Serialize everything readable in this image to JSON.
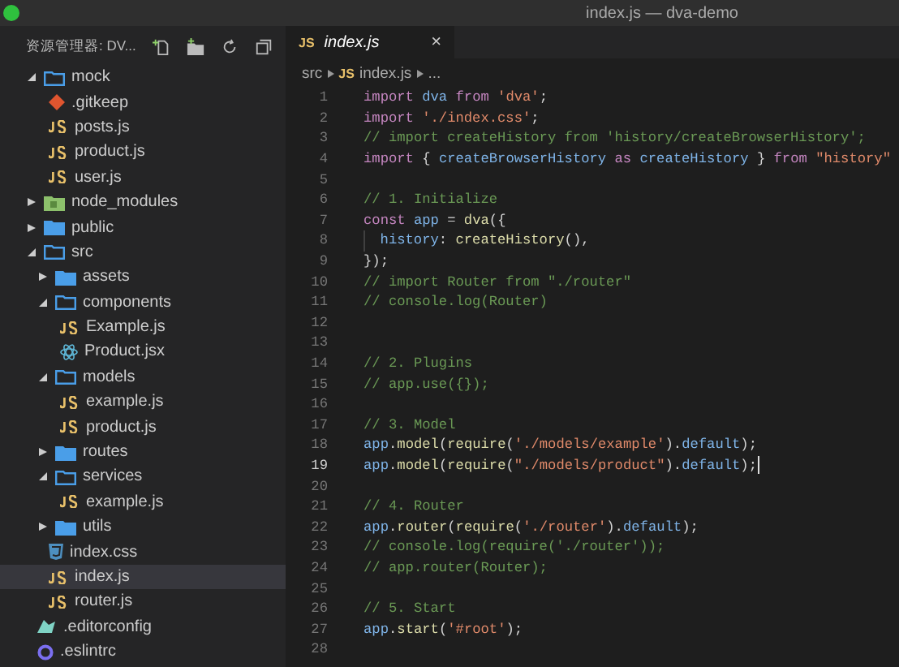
{
  "window": {
    "title": "index.js — dva-demo"
  },
  "sidebar": {
    "title": "资源管理器: DV...",
    "tree": [
      {
        "label": "mock",
        "kind": "folder",
        "expanded": true,
        "selected": false,
        "children": [
          {
            "label": ".gitkeep",
            "kind": "git",
            "selected": false
          },
          {
            "label": "posts.js",
            "kind": "js",
            "selected": false
          },
          {
            "label": "product.js",
            "kind": "js",
            "selected": false
          },
          {
            "label": "user.js",
            "kind": "js",
            "selected": false
          }
        ]
      },
      {
        "label": "node_modules",
        "kind": "node",
        "expanded": false,
        "selected": false
      },
      {
        "label": "public",
        "kind": "folder",
        "expanded": false,
        "selected": false
      },
      {
        "label": "src",
        "kind": "folder",
        "expanded": true,
        "selected": false,
        "children": [
          {
            "label": "assets",
            "kind": "folder",
            "expanded": false,
            "selected": false
          },
          {
            "label": "components",
            "kind": "folder",
            "expanded": true,
            "selected": false,
            "children": [
              {
                "label": "Example.js",
                "kind": "js",
                "selected": false
              },
              {
                "label": "Product.jsx",
                "kind": "jsx",
                "selected": false
              }
            ]
          },
          {
            "label": "models",
            "kind": "folder",
            "expanded": true,
            "selected": false,
            "children": [
              {
                "label": "example.js",
                "kind": "js",
                "selected": false
              },
              {
                "label": "product.js",
                "kind": "js",
                "selected": false
              }
            ]
          },
          {
            "label": "routes",
            "kind": "folder",
            "expanded": false,
            "selected": false
          },
          {
            "label": "services",
            "kind": "folder",
            "expanded": true,
            "selected": false,
            "children": [
              {
                "label": "example.js",
                "kind": "js",
                "selected": false
              }
            ]
          },
          {
            "label": "utils",
            "kind": "folder",
            "expanded": false,
            "selected": false
          },
          {
            "label": "index.css",
            "kind": "css",
            "selected": false
          },
          {
            "label": "index.js",
            "kind": "js",
            "selected": true
          },
          {
            "label": "router.js",
            "kind": "js",
            "selected": false
          }
        ]
      },
      {
        "label": ".editorconfig",
        "kind": "editorconfig",
        "selected": false
      },
      {
        "label": ".eslintrc",
        "kind": "eslint",
        "selected": false
      }
    ]
  },
  "tabs": [
    {
      "label": "index.js",
      "badge": "JS",
      "close": "×",
      "selected": true
    }
  ],
  "breadcrumb": [
    {
      "label": "src"
    },
    {
      "label": "index.js",
      "badge": "JS"
    },
    {
      "label": "..."
    }
  ],
  "editor": {
    "lines": [
      {
        "number": "1",
        "current": false,
        "tokens": [
          {
            "kind": "kw",
            "text": "import "
          },
          {
            "kind": "var",
            "text": "dva "
          },
          {
            "kind": "kw",
            "text": "from "
          },
          {
            "kind": "str",
            "text": "'dva'"
          },
          {
            "kind": "plain",
            "text": ";"
          }
        ]
      },
      {
        "number": "2",
        "current": false,
        "tokens": [
          {
            "kind": "kw",
            "text": "import "
          },
          {
            "kind": "str",
            "text": "'./index.css'"
          },
          {
            "kind": "plain",
            "text": ";"
          }
        ]
      },
      {
        "number": "3",
        "current": false,
        "tokens": [
          {
            "kind": "com",
            "text": "// import createHistory from 'history/createBrowserHistory';"
          }
        ]
      },
      {
        "number": "4",
        "current": false,
        "tokens": [
          {
            "kind": "kw",
            "text": "import "
          },
          {
            "kind": "plain",
            "text": "{ "
          },
          {
            "kind": "var",
            "text": "createBrowserHistory "
          },
          {
            "kind": "kw",
            "text": "as "
          },
          {
            "kind": "var",
            "text": "createHistory "
          },
          {
            "kind": "plain",
            "text": "} "
          },
          {
            "kind": "kw",
            "text": "from "
          },
          {
            "kind": "str",
            "text": "\"history\""
          }
        ]
      },
      {
        "number": "5",
        "current": false
      },
      {
        "number": "6",
        "current": false,
        "tokens": [
          {
            "kind": "com",
            "text": "// 1. Initialize"
          }
        ]
      },
      {
        "number": "7",
        "current": false,
        "tokens": [
          {
            "kind": "kw",
            "text": "const "
          },
          {
            "kind": "var",
            "text": "app "
          },
          {
            "kind": "plain",
            "text": "= "
          },
          {
            "kind": "fn",
            "text": "dva"
          },
          {
            "kind": "plain",
            "text": "({"
          }
        ]
      },
      {
        "number": "8",
        "current": false,
        "indented": true,
        "tokens": [
          {
            "kind": "var",
            "text": "history"
          },
          {
            "kind": "plain",
            "text": ": "
          },
          {
            "kind": "fn",
            "text": "createHistory"
          },
          {
            "kind": "plain",
            "text": "(),"
          }
        ]
      },
      {
        "number": "9",
        "current": false,
        "tokens": [
          {
            "kind": "plain",
            "text": "});"
          }
        ]
      },
      {
        "number": "10",
        "current": false,
        "tokens": [
          {
            "kind": "com",
            "text": "// import Router from \"./router\""
          }
        ]
      },
      {
        "number": "11",
        "current": false,
        "tokens": [
          {
            "kind": "com",
            "text": "// console.log(Router)"
          }
        ]
      },
      {
        "number": "12",
        "current": false
      },
      {
        "number": "13",
        "current": false
      },
      {
        "number": "14",
        "current": false,
        "tokens": [
          {
            "kind": "com",
            "text": "// 2. Plugins"
          }
        ]
      },
      {
        "number": "15",
        "current": false,
        "tokens": [
          {
            "kind": "com",
            "text": "// app.use({});"
          }
        ]
      },
      {
        "number": "16",
        "current": false
      },
      {
        "number": "17",
        "current": false,
        "tokens": [
          {
            "kind": "com",
            "text": "// 3. Model"
          }
        ]
      },
      {
        "number": "18",
        "current": false,
        "tokens": [
          {
            "kind": "var",
            "text": "app"
          },
          {
            "kind": "plain",
            "text": "."
          },
          {
            "kind": "fn",
            "text": "model"
          },
          {
            "kind": "plain",
            "text": "("
          },
          {
            "kind": "fn",
            "text": "require"
          },
          {
            "kind": "plain",
            "text": "("
          },
          {
            "kind": "str",
            "text": "'./models/example'"
          },
          {
            "kind": "plain",
            "text": ")."
          },
          {
            "kind": "var",
            "text": "default"
          },
          {
            "kind": "plain",
            "text": ");"
          }
        ]
      },
      {
        "number": "19",
        "current": true,
        "tokens": [
          {
            "kind": "var",
            "text": "app"
          },
          {
            "kind": "plain",
            "text": "."
          },
          {
            "kind": "fn",
            "text": "model"
          },
          {
            "kind": "plain",
            "text": "("
          },
          {
            "kind": "fn",
            "text": "require"
          },
          {
            "kind": "plain",
            "text": "("
          },
          {
            "kind": "str",
            "text": "\"./models/product\""
          },
          {
            "kind": "plain",
            "text": ")."
          },
          {
            "kind": "var",
            "text": "default"
          },
          {
            "kind": "plain",
            "text": ");"
          }
        ]
      },
      {
        "number": "20",
        "current": false
      },
      {
        "number": "21",
        "current": false,
        "tokens": [
          {
            "kind": "com",
            "text": "// 4. Router"
          }
        ]
      },
      {
        "number": "22",
        "current": false,
        "tokens": [
          {
            "kind": "var",
            "text": "app"
          },
          {
            "kind": "plain",
            "text": "."
          },
          {
            "kind": "fn",
            "text": "router"
          },
          {
            "kind": "plain",
            "text": "("
          },
          {
            "kind": "fn",
            "text": "require"
          },
          {
            "kind": "plain",
            "text": "("
          },
          {
            "kind": "str",
            "text": "'./router'"
          },
          {
            "kind": "plain",
            "text": ")."
          },
          {
            "kind": "var",
            "text": "default"
          },
          {
            "kind": "plain",
            "text": ");"
          }
        ]
      },
      {
        "number": "23",
        "current": false,
        "tokens": [
          {
            "kind": "com",
            "text": "// console.log(require('./router'));"
          }
        ]
      },
      {
        "number": "24",
        "current": false,
        "tokens": [
          {
            "kind": "com",
            "text": "// app.router(Router);"
          }
        ]
      },
      {
        "number": "25",
        "current": false
      },
      {
        "number": "26",
        "current": false,
        "tokens": [
          {
            "kind": "com",
            "text": "// 5. Start"
          }
        ]
      },
      {
        "number": "27",
        "current": false,
        "tokens": [
          {
            "kind": "var",
            "text": "app"
          },
          {
            "kind": "plain",
            "text": "."
          },
          {
            "kind": "fn",
            "text": "start"
          },
          {
            "kind": "plain",
            "text": "("
          },
          {
            "kind": "str",
            "text": "'#root'"
          },
          {
            "kind": "plain",
            "text": ");"
          }
        ]
      },
      {
        "number": "28",
        "current": false
      }
    ]
  }
}
